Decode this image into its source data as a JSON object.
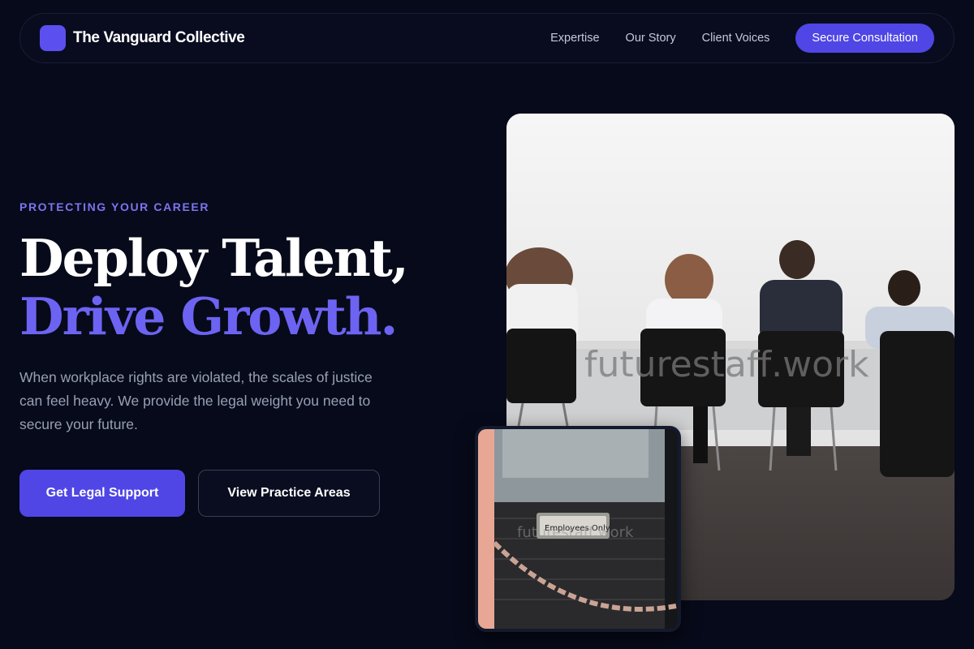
{
  "brand": {
    "name": "The Vanguard Collective",
    "accent": "#5b4ff0"
  },
  "nav": {
    "links": [
      "Expertise",
      "Our Story",
      "Client Voices"
    ],
    "cta": "Secure Consultation"
  },
  "hero": {
    "eyebrow": "PROTECTING YOUR CAREER",
    "headline_line1": "Deploy Talent,",
    "headline_line2": "Drive Growth.",
    "lede": "When workplace rights are violated, the scales of justice can feel heavy. We provide the legal weight you need to secure your future.",
    "primary_button": "Get Legal Support",
    "secondary_button": "View Practice Areas"
  },
  "images": {
    "main_watermark": "futurestaff.work",
    "sub_watermark": "futurestaff.work",
    "sub_sign_text": "Employees Only"
  },
  "colors": {
    "background": "#070a1a",
    "primary": "#4f46e5",
    "headline_accent": "#6d63f2",
    "eyebrow": "#7d74f0"
  }
}
